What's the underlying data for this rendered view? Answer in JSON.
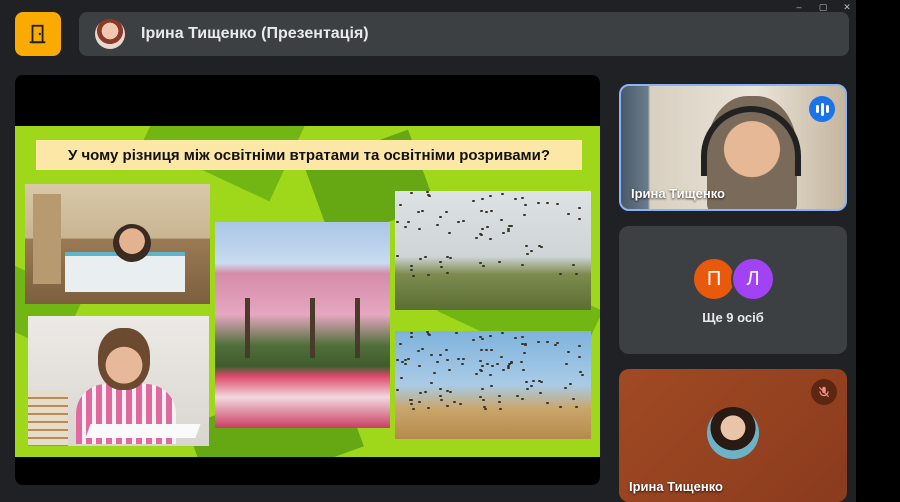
{
  "window_controls": [
    "–",
    "▢",
    "✕"
  ],
  "meeting": {
    "presenter_title": "Ірина Тищенко (Презентація)"
  },
  "slide": {
    "question": "У чому різниця між освітніми втратами та освітніми розривами?"
  },
  "participants": {
    "speaker_name": "Ірина Тищенко",
    "others_initials": [
      "П",
      "Л"
    ],
    "others_label": "Ще 9 осіб",
    "self_name": "Ірина Тищенко"
  },
  "colors": {
    "accent": "#f9ab00",
    "speaking_indicator": "#1a73e8",
    "avatar_p": "#e8590c",
    "avatar_l": "#a142f4",
    "slide_green": "#9fd81b"
  }
}
